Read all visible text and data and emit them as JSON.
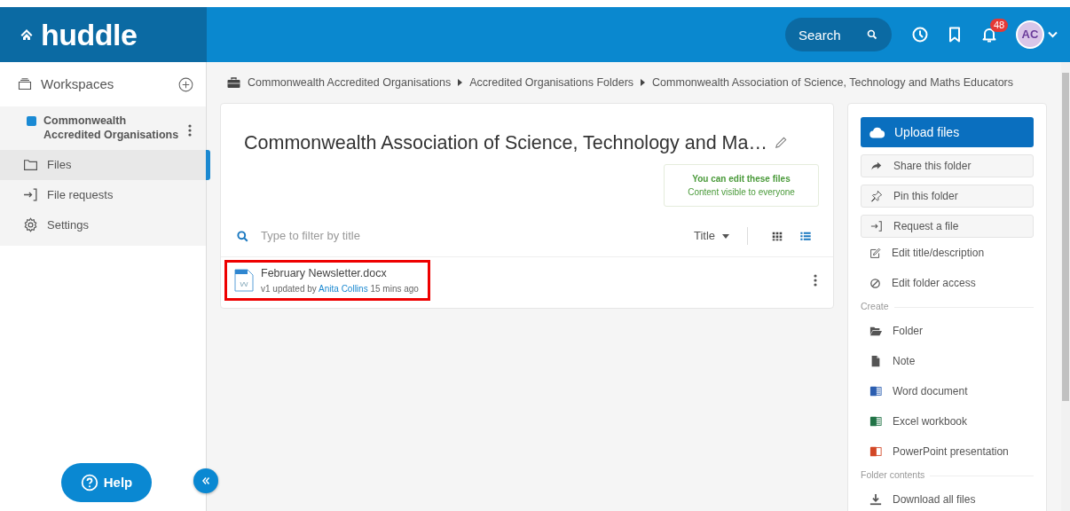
{
  "app": {
    "logo": "huddle"
  },
  "header": {
    "search": {
      "placeholder": "Search"
    },
    "notifications": {
      "count": "48"
    },
    "avatar": {
      "initials": "AC"
    }
  },
  "sidebar": {
    "title": "Workspaces",
    "workspace": {
      "name": "Commonwealth Accredited Organisations",
      "color": "#1a8ad4"
    },
    "items": [
      {
        "label": "Files",
        "kind": "folder",
        "selected": true
      },
      {
        "label": "File requests",
        "kind": "request",
        "selected": false
      },
      {
        "label": "Settings",
        "kind": "gear",
        "selected": false
      }
    ],
    "help": "Help"
  },
  "breadcrumb": [
    "Commonwealth Accredited Organisations",
    "Accredited Organisations Folders",
    "Commonwealth Association of Science, Technology and Maths Educators"
  ],
  "folder": {
    "title": "Commonwealth Association of Science, Technology and Ma…",
    "permissions": {
      "title": "You can edit these files",
      "subtitle": "Content visible to everyone"
    },
    "filter": {
      "placeholder": "Type to filter by title"
    },
    "sort": "Title",
    "views": [
      {
        "kind": "grid",
        "selected": false
      },
      {
        "kind": "list",
        "selected": true
      }
    ],
    "files": [
      {
        "name": "February Newsletter.docx",
        "updated": "v1 updated by",
        "author": "Anita Collins",
        "time": "15 mins ago",
        "highlighted": true
      }
    ]
  },
  "actions": {
    "upload": "Upload files",
    "buttons": [
      {
        "label": "Share this folder",
        "kind": "share"
      },
      {
        "label": "Pin this folder",
        "kind": "pin"
      },
      {
        "label": "Request a file",
        "kind": "request"
      }
    ],
    "links": [
      {
        "label": "Edit title/description",
        "kind": "edit"
      },
      {
        "label": "Edit folder access",
        "kind": "block"
      }
    ],
    "sections": [
      {
        "title": "Create",
        "items": [
          {
            "label": "Folder",
            "kind": "folder-open"
          },
          {
            "label": "Note",
            "kind": "note"
          },
          {
            "label": "Word document",
            "kind": "word"
          },
          {
            "label": "Excel workbook",
            "kind": "excel"
          },
          {
            "label": "PowerPoint presentation",
            "kind": "powerpoint"
          }
        ]
      },
      {
        "title": "Folder contents",
        "items": [
          {
            "label": "Download all files",
            "kind": "download"
          }
        ]
      }
    ]
  }
}
